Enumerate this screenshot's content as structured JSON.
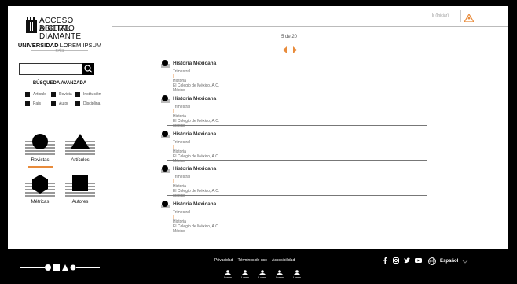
{
  "sidebar": {
    "logo_line1": "ACCESO ABIERTO",
    "logo_line2": "DIGITAL DIAMANTE",
    "univ_bold": "UNIVERSIDAD",
    "univ_rest": "LOREM IPSUM",
    "country": "PAÍS",
    "search_value": "",
    "advanced": "BÚSQUEDA AVANZADA",
    "filters": [
      "Artículo",
      "Revista",
      "Institución",
      "País",
      "Autor",
      "Disciplina"
    ],
    "tiles": [
      {
        "label": "Revistas",
        "icon": "circle-icon"
      },
      {
        "label": "Artículos",
        "icon": "triangle-icon"
      },
      {
        "label": "Métricas",
        "icon": "hexagon-icon"
      },
      {
        "label": "Autores",
        "icon": "square-icon"
      }
    ]
  },
  "topbar": {
    "login": "Ir (Iniciar)"
  },
  "pager": {
    "label": "5 de 20"
  },
  "results": [
    {
      "title": "Historia Mexicana",
      "periodicity": "Trimestral",
      "discipline": "Historia",
      "publisher": "El Colegio de México, A.C.",
      "country": "México"
    },
    {
      "title": "Historia Mexicana",
      "periodicity": "Trimestral",
      "discipline": "Historia",
      "publisher": "El Colegio de México, A.C.",
      "country": "México"
    },
    {
      "title": "Historia Mexicana",
      "periodicity": "Trimestral",
      "discipline": "Historia",
      "publisher": "El Colegio de México, A.C.",
      "country": "México"
    },
    {
      "title": "Historia Mexicana",
      "periodicity": "Trimestral",
      "discipline": "Historia",
      "publisher": "El Colegio de México, A.C.",
      "country": "México"
    },
    {
      "title": "Historia Mexicana",
      "periodicity": "Trimestral",
      "discipline": "Historia",
      "publisher": "El Colegio de México, A.C.",
      "country": "México"
    }
  ],
  "footer": {
    "links": [
      "Privacidad",
      "Términos de uso",
      "Accesibilidad"
    ],
    "language": "Español",
    "people": [
      "Lorem",
      "Lorem",
      "Lorem",
      "Lorem",
      "Lorem"
    ]
  },
  "colors": {
    "accent": "#e88b3b"
  }
}
